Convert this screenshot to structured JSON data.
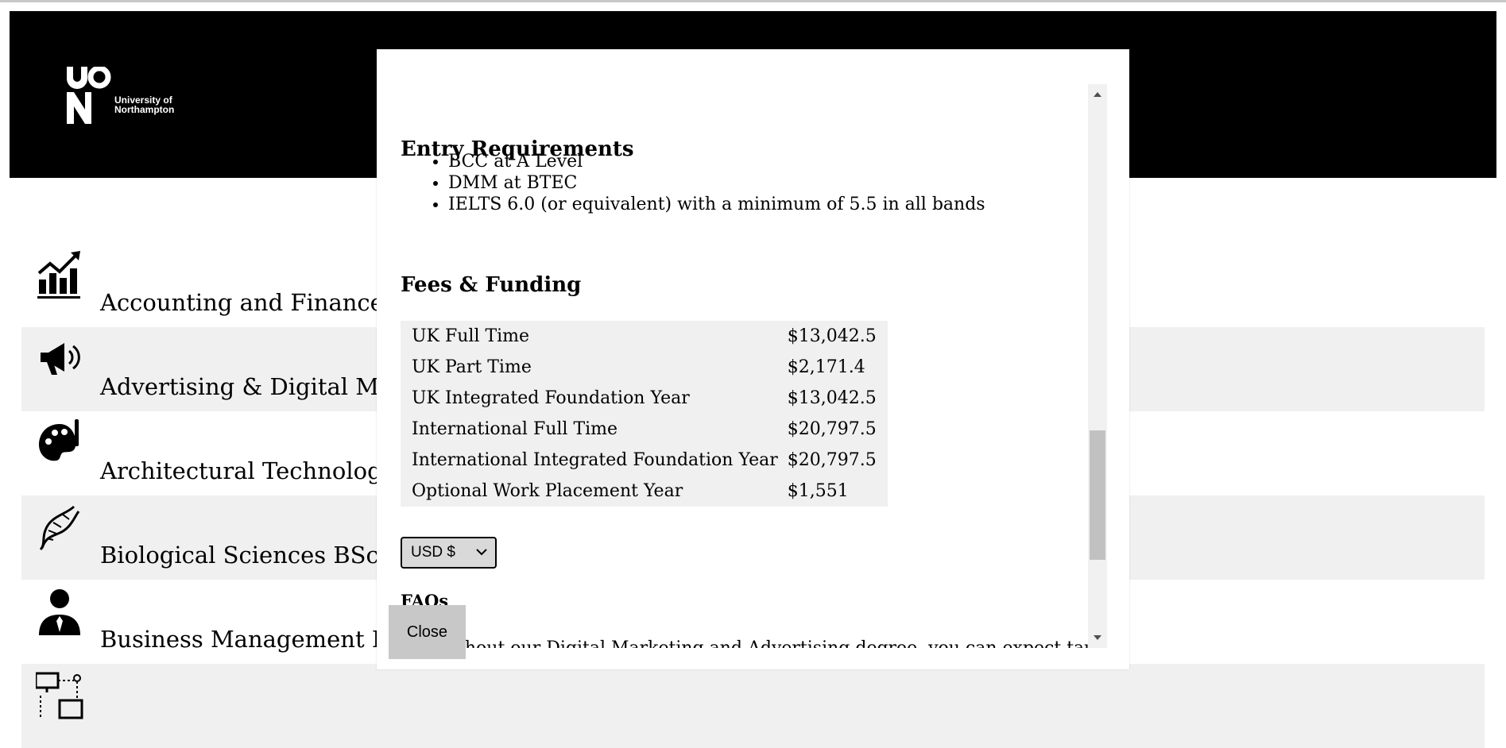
{
  "header": {
    "logo_letters": "UON",
    "logo_text_line1": "University of",
    "logo_text_line2": "Northampton"
  },
  "courses": [
    {
      "label": "Accounting and Finance BSc",
      "icon": "chart-trending-up-icon"
    },
    {
      "label": "Advertising & Digital Marke",
      "icon": "megaphone-icon"
    },
    {
      "label": "Architectural Technology BS",
      "icon": "palette-icon"
    },
    {
      "label": "Biological Sciences BSc (Ho",
      "icon": "dna-icon"
    },
    {
      "label": "Business Management BA (H",
      "icon": "businessperson-icon"
    },
    {
      "label": "",
      "icon": "network-diagram-icon"
    }
  ],
  "modal": {
    "entry_heading": "Entry Requirements",
    "entry_items": [
      "BCC at A Level",
      "DMM at BTEC",
      "IELTS 6.0 (or equivalent) with a minimum of 5.5 in all bands"
    ],
    "fees_heading": "Fees & Funding",
    "fees": [
      {
        "label": "UK Full Time",
        "amount": "$13,042.5"
      },
      {
        "label": "UK Part Time",
        "amount": "$2,171.4"
      },
      {
        "label": "UK Integrated Foundation Year",
        "amount": "$13,042.5"
      },
      {
        "label": "International Full Time",
        "amount": "$20,797.5"
      },
      {
        "label": "International Integrated Foundation Year",
        "amount": "$20,797.5"
      },
      {
        "label": "Optional Work Placement Year",
        "amount": "$1,551"
      }
    ],
    "currency_selected": "USD $",
    "faqs_heading": "FAQs",
    "faq_text": "Throughout our Digital Marketing and Advertising degree, you can expect taught study",
    "close_label": "Close"
  }
}
